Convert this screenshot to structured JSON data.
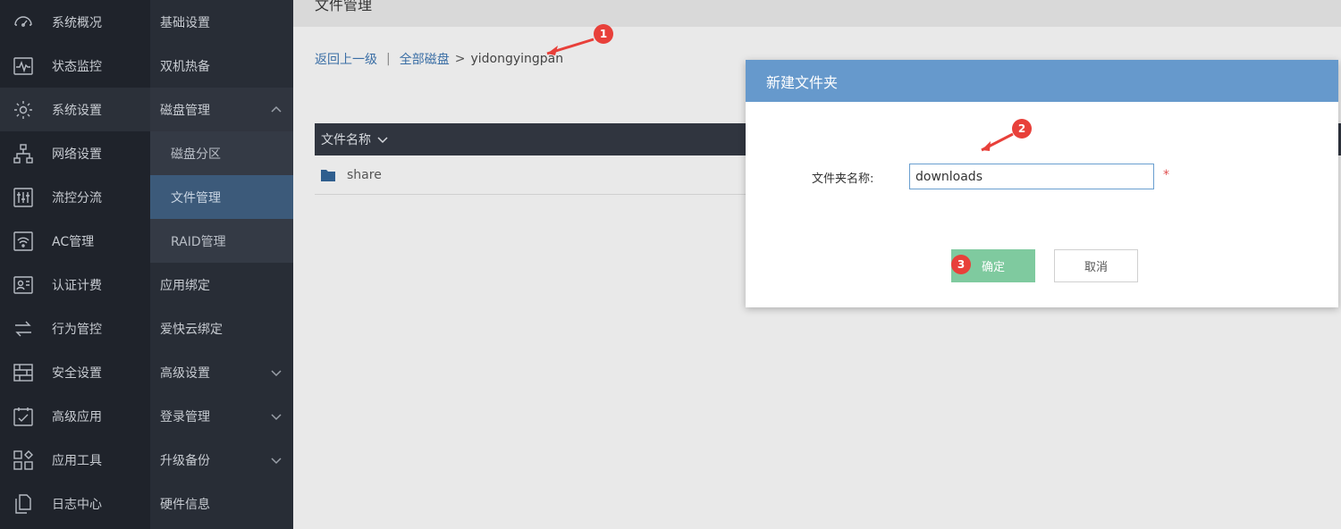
{
  "sidebar_primary": {
    "items": [
      {
        "label": "系统概况",
        "icon": "dashboard-gauge-icon"
      },
      {
        "label": "状态监控",
        "icon": "monitor-pulse-icon"
      },
      {
        "label": "系统设置",
        "icon": "gear-icon",
        "active": true
      },
      {
        "label": "网络设置",
        "icon": "network-tree-icon"
      },
      {
        "label": "流控分流",
        "icon": "sliders-icon"
      },
      {
        "label": "AC管理",
        "icon": "wifi-ap-icon"
      },
      {
        "label": "认证计费",
        "icon": "id-card-icon"
      },
      {
        "label": "行为管控",
        "icon": "swap-arrows-icon"
      },
      {
        "label": "安全设置",
        "icon": "firewall-icon"
      },
      {
        "label": "高级应用",
        "icon": "checklist-icon"
      },
      {
        "label": "应用工具",
        "icon": "apps-grid-icon"
      },
      {
        "label": "日志中心",
        "icon": "log-files-icon"
      }
    ]
  },
  "sidebar_secondary": {
    "items": [
      {
        "label": "基础设置"
      },
      {
        "label": "双机热备"
      },
      {
        "label": "磁盘管理",
        "expanded": true
      },
      {
        "label": "磁盘分区",
        "sub": true
      },
      {
        "label": "文件管理",
        "sub": true,
        "active": true
      },
      {
        "label": "RAID管理",
        "sub": true
      },
      {
        "label": "应用绑定"
      },
      {
        "label": "爱快云绑定"
      },
      {
        "label": "高级设置",
        "collapsed": true
      },
      {
        "label": "登录管理",
        "collapsed": true
      },
      {
        "label": "升级备份",
        "collapsed": true
      },
      {
        "label": "硬件信息"
      }
    ]
  },
  "main": {
    "title": "文件管理",
    "breadcrumb": {
      "back": "返回上一级",
      "separator": "|",
      "root": "全部磁盘",
      "arrow": ">",
      "current": "yidongyingpan"
    },
    "table": {
      "column": "文件名称",
      "rows": [
        {
          "name": "share"
        }
      ]
    }
  },
  "modal": {
    "title": "新建文件夹",
    "field_label": "文件夹名称:",
    "field_value": "downloads",
    "required_mark": "*",
    "ok_label": "确定",
    "cancel_label": "取消"
  },
  "annotations": {
    "marker1": "1",
    "marker2": "2",
    "marker3": "3"
  },
  "colors": {
    "sidebar_bg": "#1f232b",
    "submenu_active": "#3c5a7a",
    "modal_header": "#6699cc",
    "ok_button": "#7fca9f",
    "marker": "#e8403a"
  }
}
